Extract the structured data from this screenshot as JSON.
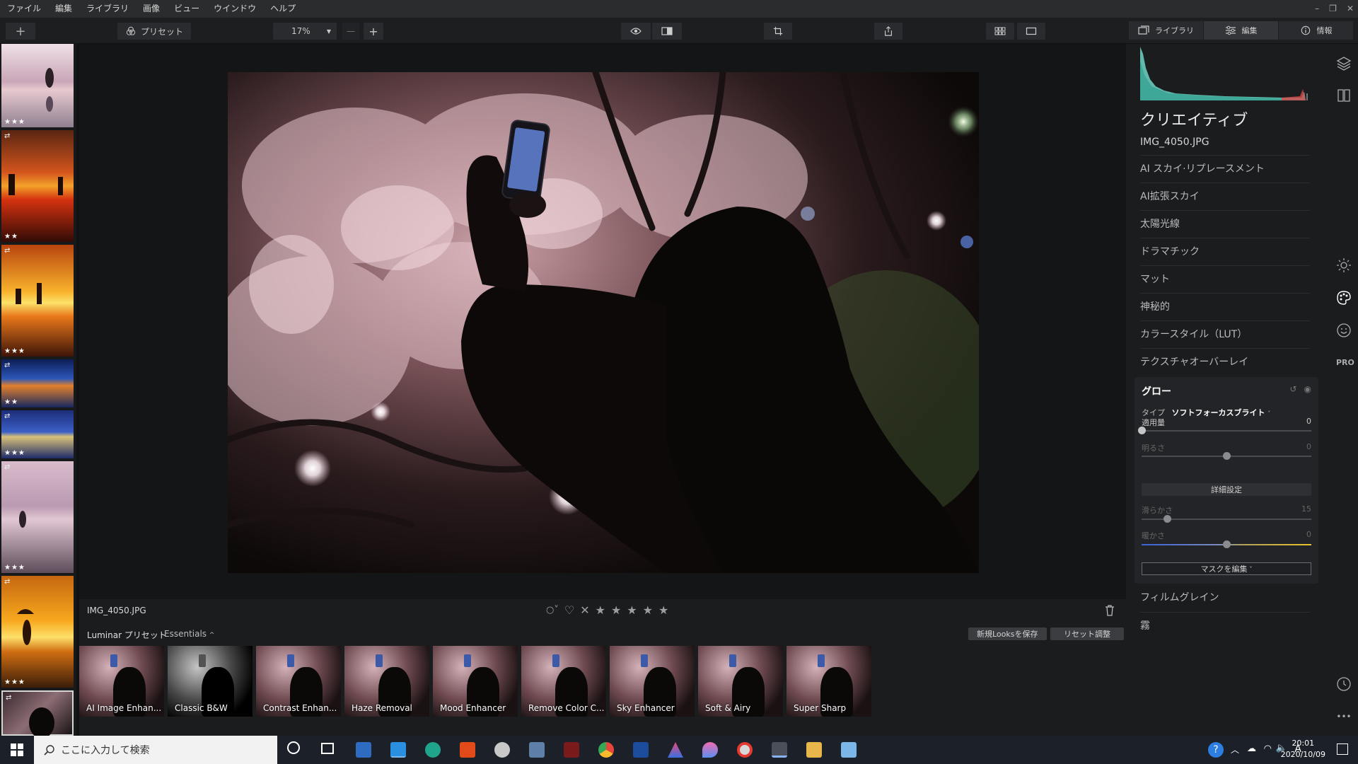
{
  "menubar": {
    "items": [
      "ファイル",
      "編集",
      "ライブラリ",
      "画像",
      "ビュー",
      "ウインドウ",
      "ヘルプ"
    ]
  },
  "toolbar": {
    "preset_label": "プリセット",
    "zoom_value": "17%",
    "zoom_minus": "—",
    "zoom_plus": "+"
  },
  "right_tabs": {
    "library": "ライブラリ",
    "edit": "編集",
    "info": "情報"
  },
  "filmstrip": {
    "items": [
      {
        "stars": "★★★",
        "edited": false
      },
      {
        "stars": "★★",
        "edited": true
      },
      {
        "stars": "★★★",
        "edited": true
      },
      {
        "stars": "★★",
        "edited": true
      },
      {
        "stars": "★★★",
        "edited": true
      },
      {
        "stars": "★★★",
        "edited": true
      },
      {
        "stars": "★★★",
        "edited": true
      },
      {
        "stars": "",
        "edited": true
      }
    ]
  },
  "info": {
    "filename": "IMG_4050.JPG",
    "stars": [
      "★",
      "★",
      "★",
      "★",
      "★"
    ]
  },
  "presets": {
    "tab_label": "Luminar プリセット",
    "category": "Essentials",
    "save_look": "新規Looksを保存",
    "reset": "リセット調整",
    "items": [
      "AI Image Enhan...",
      "Classic B&W",
      "Contrast Enhan...",
      "Haze Removal",
      "Mood Enhancer",
      "Remove Color C...",
      "Sky Enhancer",
      "Soft & Airy",
      "Super Sharp"
    ]
  },
  "panel": {
    "title": "クリエイティブ",
    "filename": "IMG_4050.JPG",
    "tools": [
      "AI スカイ·リプレースメント",
      "AI拡張スカイ",
      "太陽光線",
      "ドラマチック",
      "マット",
      "神秘的",
      "カラースタイル（LUT）",
      "テクスチャオーバーレイ"
    ],
    "glow": {
      "title": "グロー",
      "type_label": "タイプ",
      "type_value": "ソフトフォーカスブライト",
      "amount_label": "適用量",
      "amount_value": "0",
      "brightness_label": "明るさ",
      "brightness_value": "0",
      "advanced_label": "詳細設定",
      "smoothness_label": "滑らかさ",
      "smoothness_value": "15",
      "warmth_label": "暖かさ",
      "warmth_value": "0",
      "mask_label": "マスクを編集"
    },
    "after_tools": [
      "フィルムグレイン",
      "霧"
    ]
  },
  "side_strip": {
    "pro_label": "PRO",
    "more": "•••"
  },
  "taskbar": {
    "search_placeholder": "ここに入力して検索",
    "ime": "A",
    "time": "20:01",
    "date": "2020/10/09"
  },
  "colors": {
    "accent": "#3d8bd9",
    "panel_bg": "#1b1c1e"
  }
}
